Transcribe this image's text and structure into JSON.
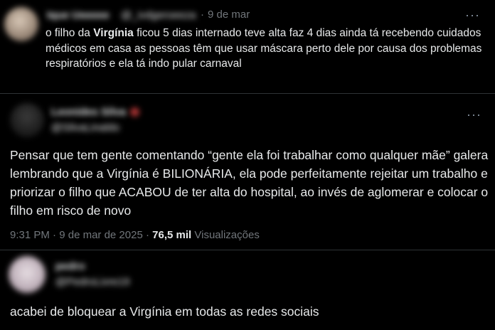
{
  "tweets": [
    {
      "author_name": "Ique Ueeeee",
      "author_handle": "@_ivdgeroeeza",
      "separator": "·",
      "date": "9 de mar",
      "text_parts": [
        {
          "text": "o filho da ",
          "bold": false
        },
        {
          "text": "Virgínia",
          "bold": true
        },
        {
          "text": " ficou 5 dias internado teve alta faz 4 dias ainda tá recebendo cuidados médicos em casa as pessoas têm que usar máscara perto dele por causa dos problemas respiratórios e ela tá indo pular carnaval",
          "bold": false
        }
      ],
      "more_icon": "more-horizontal-icon"
    },
    {
      "author_name": "Leonides Silva",
      "author_handle": "@SilvaLinaldo",
      "text": "Pensar que tem gente comentando “gente ela foi trabalhar como qualquer mãe” galera lembrando que a Virgínia é BILIONÁRIA, ela pode perfeitamente rejeitar um trabalho e priorizar o filho que ACABOU de ter alta do hospital, ao invés de aglomerar e colocar o filho em risco de novo",
      "time": "9:31 PM",
      "separator": "·",
      "date": "9 de mar de 2025",
      "separator2": "·",
      "views_count": "76,5 mil",
      "views_label": "Visualizações",
      "more_icon": "more-horizontal-icon"
    },
    {
      "author_name": "pedro",
      "author_handle": "@PedroLivre19",
      "text": "acabei de bloquear a Virgínia em todas as redes sociais"
    }
  ],
  "colors": {
    "background": "#000000",
    "text_primary": "#e7e9ea",
    "text_secondary": "#71767b",
    "divider": "#2f3336"
  }
}
